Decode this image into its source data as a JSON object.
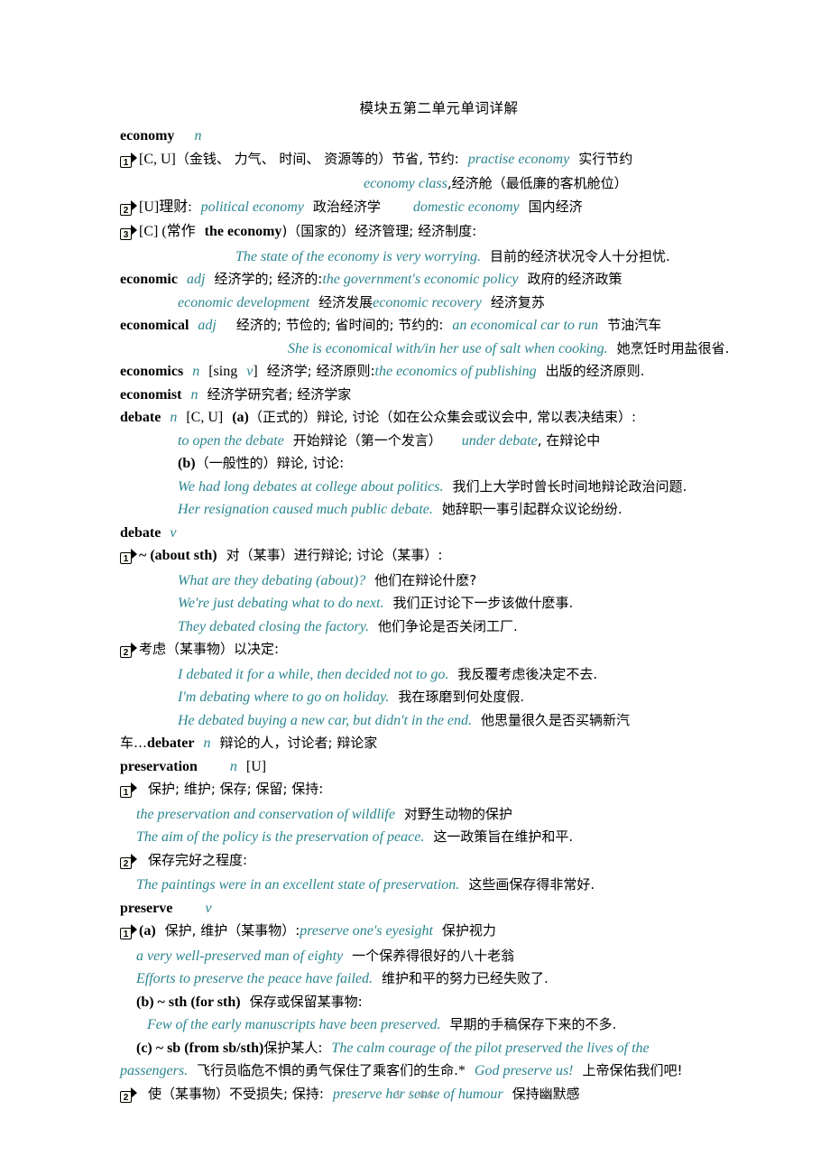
{
  "document": {
    "title": "模块五第二单元单词详解",
    "accent_color": "#2b8590",
    "text_color": "#000000",
    "footer_color": "#9b9b9b"
  },
  "footer": {
    "page_indicator": "1 / 44",
    "current_page": "1",
    "separator": "/",
    "total_pages": "44"
  },
  "entries": {
    "economy": {
      "headword": "economy",
      "pos": "n",
      "s1_marker": "1",
      "s1_label": "[C, U]",
      "s1_cn": "（金钱、 力气、 时间、 资源等的）节省, 节约:",
      "s1_en": "practise economy",
      "s1_en_cn": "实行节约",
      "s1b_en": "economy class",
      "s1b_cn": ",经济舱（最低廉的客机舱位）",
      "s2_marker": "2",
      "s2_label": "[U]理财:",
      "s2_en1": "political economy",
      "s2_cn1": "政治经济学",
      "s2_en2": "domestic economy",
      "s2_cn2": "国内经济",
      "s3_marker": "3",
      "s3_label": "[C] (常作",
      "s3_bold": "the economy",
      "s3_cn": ")（国家的）经济管理; 经济制度:",
      "s3_en": "The state of the economy is very worrying.",
      "s3_en_cn": "目前的经济状况令人十分担忧."
    },
    "economic": {
      "headword": "economic",
      "pos": "adj",
      "cn": "经济学的; 经济的:",
      "en1": "the government's economic policy",
      "cn1": "政府的经济政策",
      "en2": "economic development",
      "cn2": "经济发展",
      "en3": "economic recovery",
      "cn3": "经济复苏"
    },
    "economical": {
      "headword": "economical",
      "pos": "adj",
      "cn": "经济的; 节俭的; 省时间的; 节约的:",
      "en1": "an economical car to run",
      "cn1": "节油汽车",
      "en2": "She is economical with/in her use of salt when cooking.",
      "cn2": "她烹饪时用盐很省."
    },
    "economics": {
      "headword": "economics",
      "pos": "n",
      "gram": "[sing",
      "gram_v": "v",
      "gram_close": "]",
      "cn": "经济学; 经济原则:",
      "en1": "the economics of publishing",
      "cn1": "出版的经济原则."
    },
    "economist": {
      "headword": "economist",
      "pos": "n",
      "cn": "经济学研究者; 经济学家"
    },
    "debate_n": {
      "headword": "debate",
      "pos": "n",
      "label": "[C, U]",
      "sense_a": "(a)",
      "a_cn": "（正式的）辩论, 讨论（如在公众集会或议会中, 常以表决结束）:",
      "a_en1": "to open the debate",
      "a_cn1": "开始辩论（第一个发言）",
      "a_en2": "under debate",
      "a_cn2": ", 在辩论中",
      "sense_b": "(b)",
      "b_cn": "（一般性的）辩论, 讨论:",
      "b_en1": "We had long debates at college about politics.",
      "b_cn1": "我们上大学时曾长时间地辩论政治问题.",
      "b_en2": "Her resignation caused much public debate.",
      "b_cn2": "她辞职一事引起群众议论纷纷."
    },
    "debate_v": {
      "headword": "debate",
      "pos": "v",
      "s1_marker": "1",
      "s1_bold": "~ (about sth)",
      "s1_cn": "对（某事）进行辩论; 讨论（某事）:",
      "s1_en1": "What are they debating (about)?",
      "s1_cn1": "他们在辩论什麽?",
      "s1_en2": "We're just debating what to do next.",
      "s1_cn2": "我们正讨论下一步该做什麽事.",
      "s1_en3": "They debated closing the factory.",
      "s1_cn3": "他们争论是否关闭工厂.",
      "s2_marker": "2",
      "s2_cn": "考虑（某事物）以决定:",
      "s2_en1": "I debated it for a while, then decided not to go.",
      "s2_cn1": "我反覆考虑後决定不去.",
      "s2_en2": "I'm debating where to go on holiday.",
      "s2_cn2": "我在琢磨到何处度假.",
      "s2_en3": "He debated buying a new car, but didn't in the end.",
      "s2_cn3": "他思量很久是否买辆新汽"
    },
    "debater": {
      "continuation": "车…",
      "headword": "debater",
      "pos": "n",
      "cn": "辩论的人，讨论者; 辩论家"
    },
    "preservation": {
      "headword": "preservation",
      "pos": "n",
      "label": "[U]",
      "s1_marker": "1",
      "s1_cn": "保护; 维护; 保存; 保留; 保持:",
      "s1_en1": "the preservation and conservation of wildlife",
      "s1_cn1": "对野生动物的保护",
      "s1_en2": "The aim of the policy is the preservation of peace.",
      "s1_cn2": "这一政策旨在维护和平.",
      "s2_marker": "2",
      "s2_cn": "保存完好之程度:",
      "s2_en1": "The paintings were in an excellent state of preservation.",
      "s2_cn1": "这些画保存得非常好."
    },
    "preserve": {
      "headword": "preserve",
      "pos": "v",
      "s1_marker": "1",
      "a_bold": "(a)",
      "a_cn": "保护, 维护（某事物）:",
      "a_en1": "preserve one's eyesight",
      "a_cn1": "保护视力",
      "a_en2": "a very well-preserved man of eighty",
      "a_cn2": "一个保养得很好的八十老翁",
      "a_en3": "Efforts to preserve the peace have failed.",
      "a_cn3": "维护和平的努力已经失败了.",
      "b_bold": "(b) ~ sth (for sth)",
      "b_cn": "保存或保留某事物:",
      "b_en1": "Few of the early manuscripts have been preserved.",
      "b_cn1": "早期的手稿保存下来的不多.",
      "c_bold": "(c) ~ sb (from sb/sth)",
      "c_cn": "保护某人:",
      "c_en1": "The calm courage of the pilot preserved the lives of the",
      "c_en1b": "passengers.",
      "c_cn1": "飞行员临危不惧的勇气保住了乘客们的生命.",
      "c_star": "*",
      "c_en2": "God preserve us!",
      "c_cn2": "上帝保佑我们吧!",
      "s2_marker": "2",
      "s2_cn": "使（某事物）不受损失; 保持:",
      "s2_en1": "preserve her sense of humour",
      "s2_cn1": "保持幽默感"
    }
  }
}
